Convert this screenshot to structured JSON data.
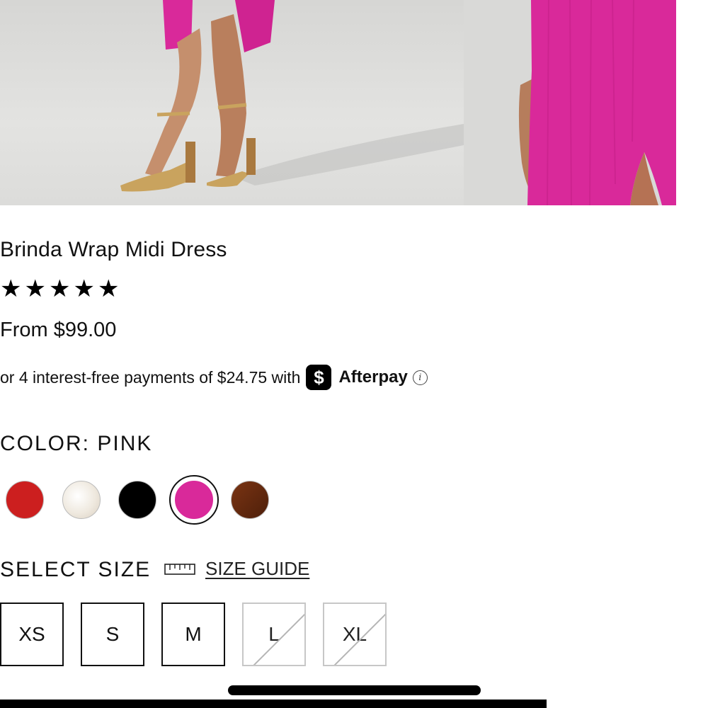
{
  "product": {
    "title": "Brinda Wrap Midi Dress",
    "rating_stars": 5,
    "price": "From $99.00"
  },
  "afterpay": {
    "text": "or 4 interest-free payments of $24.75 with",
    "logo_glyph": "$",
    "brand": "Afterpay",
    "info_icon": "info-icon"
  },
  "color": {
    "label": "COLOR:",
    "value": "PINK",
    "swatches": [
      {
        "name": "red",
        "color": "#cc1f1f"
      },
      {
        "name": "ivory",
        "color": "#f1ece4"
      },
      {
        "name": "black",
        "color": "#000000"
      },
      {
        "name": "pink",
        "color": "#d9299a",
        "selected": true
      },
      {
        "name": "brown",
        "color": "#6b2e12"
      }
    ]
  },
  "size": {
    "label": "SELECT SIZE",
    "guide_label": "SIZE GUIDE",
    "options": [
      {
        "label": "XS",
        "available": true
      },
      {
        "label": "S",
        "available": true
      },
      {
        "label": "M",
        "available": true
      },
      {
        "label": "L",
        "available": false
      },
      {
        "label": "XL",
        "available": false
      }
    ]
  },
  "colors": {
    "dress_pink": "#d9299a",
    "background": "#ffffff",
    "text": "#111111"
  }
}
